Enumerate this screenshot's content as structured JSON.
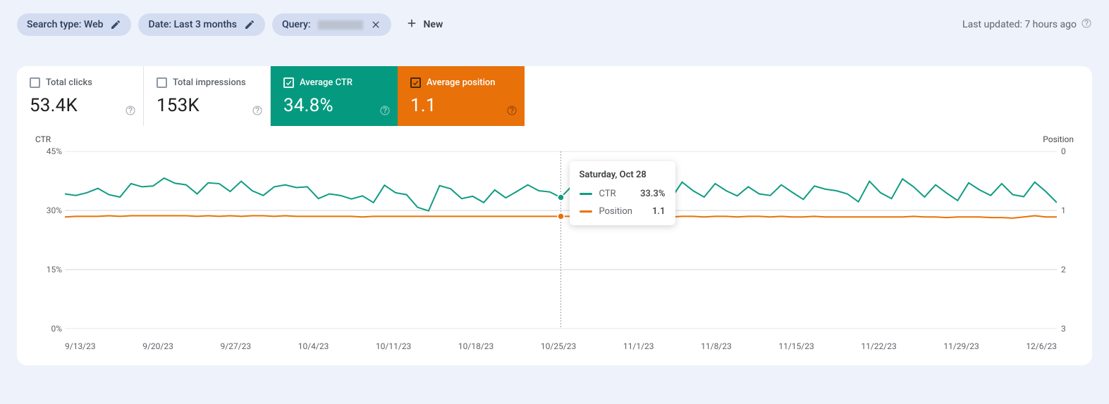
{
  "filters": {
    "searchType": {
      "label": "Search type:",
      "value": "Web"
    },
    "date": {
      "label": "Date:",
      "value": "Last 3 months"
    },
    "query": {
      "label": "Query:"
    },
    "new": "New"
  },
  "updated": "Last updated: 7 hours ago",
  "metrics": {
    "clicks": {
      "label": "Total clicks",
      "value": "53.4K",
      "checked": false
    },
    "impressions": {
      "label": "Total impressions",
      "value": "153K",
      "checked": false
    },
    "ctr": {
      "label": "Average CTR",
      "value": "34.8%",
      "checked": true
    },
    "position": {
      "label": "Average position",
      "value": "1.1",
      "checked": true
    }
  },
  "chart_data": {
    "type": "line",
    "ylabel_left": "CTR",
    "ylabel_right": "Position",
    "ylim_left": [
      0,
      45
    ],
    "ylim_right": [
      3,
      0
    ],
    "ytick_left": [
      "0%",
      "15%",
      "30%",
      "45%"
    ],
    "ytick_right": [
      "3",
      "2",
      "1",
      "0"
    ],
    "xticks": [
      "9/13/23",
      "9/20/23",
      "9/27/23",
      "10/4/23",
      "10/11/23",
      "10/18/23",
      "10/25/23",
      "11/1/23",
      "11/8/23",
      "11/15/23",
      "11/22/23",
      "11/29/23",
      "12/6/23"
    ],
    "hover": {
      "index": 45,
      "date": "Saturday, Oct 28",
      "k1": "CTR",
      "v1": "33.3%",
      "k2": "Position",
      "v2": "1.1"
    },
    "series": [
      {
        "name": "CTR",
        "color": "#0f9d82",
        "axis": "left",
        "values": [
          34.2,
          33.8,
          34.5,
          35.6,
          34.0,
          33.4,
          36.8,
          36.0,
          36.2,
          38.2,
          36.9,
          36.5,
          34.2,
          37.0,
          36.8,
          34.8,
          37.4,
          35.0,
          33.8,
          36.0,
          36.5,
          35.8,
          36.0,
          33.0,
          34.2,
          33.8,
          32.9,
          33.7,
          32.0,
          36.4,
          34.5,
          34.0,
          30.8,
          29.9,
          36.3,
          35.5,
          33.0,
          33.6,
          32.0,
          35.2,
          33.2,
          34.8,
          36.5,
          35.0,
          34.7,
          33.3,
          36.2,
          35.1,
          36.4,
          35.9,
          38.0,
          36.5,
          34.0,
          32.5,
          35.6,
          33.0,
          37.2,
          35.0,
          33.4,
          36.8,
          35.0,
          33.7,
          36.0,
          34.2,
          33.8,
          36.5,
          34.6,
          32.8,
          36.2,
          35.4,
          35.0,
          34.2,
          32.2,
          37.4,
          34.5,
          33.0,
          38.0,
          36.0,
          33.4,
          36.5,
          34.4,
          32.5,
          37.0,
          35.2,
          33.8,
          36.8,
          34.0,
          33.5,
          37.2,
          34.8,
          32.0
        ]
      },
      {
        "name": "Position",
        "color": "#e8710a",
        "axis": "right",
        "values": [
          1.11,
          1.1,
          1.1,
          1.1,
          1.09,
          1.1,
          1.09,
          1.09,
          1.09,
          1.09,
          1.09,
          1.09,
          1.1,
          1.09,
          1.1,
          1.09,
          1.1,
          1.09,
          1.09,
          1.1,
          1.09,
          1.1,
          1.1,
          1.1,
          1.1,
          1.1,
          1.1,
          1.11,
          1.1,
          1.1,
          1.1,
          1.1,
          1.1,
          1.1,
          1.1,
          1.1,
          1.1,
          1.1,
          1.1,
          1.1,
          1.1,
          1.1,
          1.1,
          1.1,
          1.1,
          1.1,
          1.1,
          1.1,
          1.1,
          1.1,
          1.1,
          1.1,
          1.1,
          1.11,
          1.1,
          1.11,
          1.1,
          1.1,
          1.11,
          1.1,
          1.1,
          1.11,
          1.1,
          1.1,
          1.11,
          1.1,
          1.11,
          1.11,
          1.1,
          1.11,
          1.11,
          1.11,
          1.11,
          1.11,
          1.11,
          1.11,
          1.11,
          1.1,
          1.11,
          1.11,
          1.12,
          1.11,
          1.11,
          1.11,
          1.12,
          1.12,
          1.13,
          1.11,
          1.09,
          1.11,
          1.11
        ]
      }
    ]
  }
}
